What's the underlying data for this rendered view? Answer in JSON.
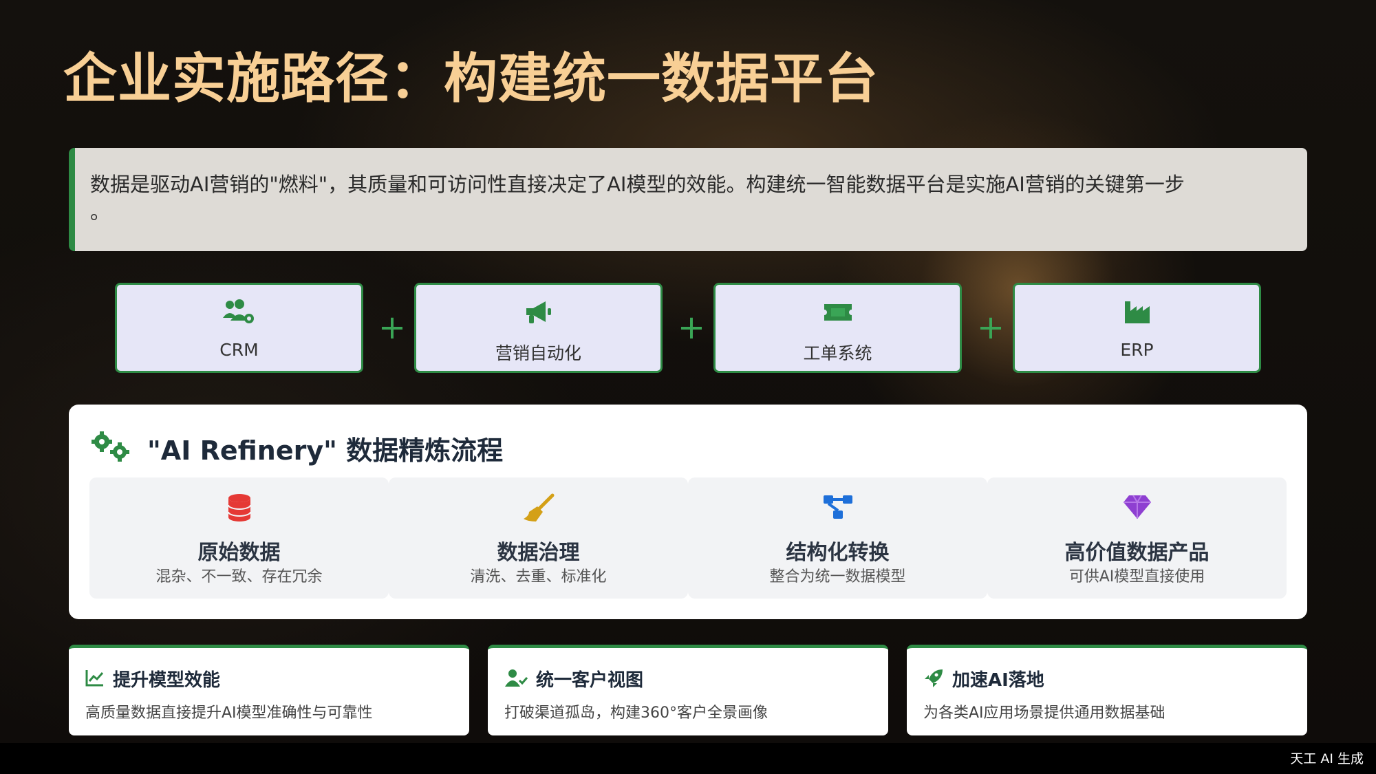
{
  "title": "企业实施路径：构建统一数据平台",
  "intro": {
    "text": "数据是驱动AI营销的\"燃料\"，其质量和可访问性直接决定了AI模型的效能。构建统一智能数据平台是实施AI营销的关键第一步",
    "tail": "。"
  },
  "sources": {
    "plus": "+",
    "items": [
      {
        "label": "CRM",
        "icon": "users-gear-icon"
      },
      {
        "label": "营销自动化",
        "icon": "megaphone-icon"
      },
      {
        "label": "工单系统",
        "icon": "ticket-icon"
      },
      {
        "label": "ERP",
        "icon": "factory-icon"
      }
    ]
  },
  "refinery": {
    "title": "\"AI Refinery\" 数据精炼流程",
    "icon": "gears-icon",
    "steps": [
      {
        "name": "原始数据",
        "desc": "混杂、不一致、存在冗余",
        "icon": "database-icon",
        "color": "#e53935"
      },
      {
        "name": "数据治理",
        "desc": "清洗、去重、标准化",
        "icon": "broom-icon",
        "color": "#d4a017"
      },
      {
        "name": "结构化转换",
        "desc": "整合为统一数据模型",
        "icon": "diagram-icon",
        "color": "#1e6fd9"
      },
      {
        "name": "高价值数据产品",
        "desc": "可供AI模型直接使用",
        "icon": "gem-icon",
        "color": "#8e3fd1"
      }
    ]
  },
  "benefits": [
    {
      "title": "提升模型效能",
      "desc": "高质量数据直接提升AI模型准确性与可靠性",
      "icon": "chart-line-icon"
    },
    {
      "title": "统一客户视图",
      "desc": "打破渠道孤岛，构建360°客户全景画像",
      "icon": "user-check-icon"
    },
    {
      "title": "加速AI落地",
      "desc": "为各类AI应用场景提供通用数据基础",
      "icon": "rocket-icon"
    }
  ],
  "footer": "天工 AI 生成",
  "colors": {
    "accent_green": "#2e8b45",
    "title_gold": "#f8cf95",
    "card_lavender": "#e6e6f7"
  }
}
